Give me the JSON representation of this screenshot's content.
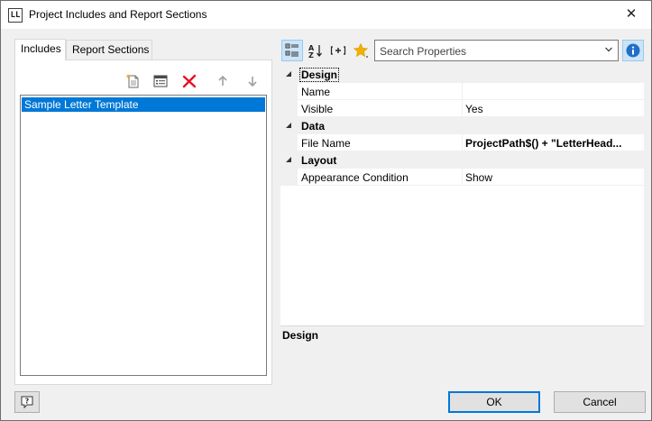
{
  "window": {
    "icon_text": "LL",
    "title": "Project Includes and Report Sections",
    "close_symbol": "✕"
  },
  "left_tabs": [
    {
      "label": "Includes",
      "active": true
    },
    {
      "label": "Report Sections",
      "active": false
    }
  ],
  "left_toolbar": {
    "icons": [
      "new-include-icon",
      "edit-properties-icon",
      "delete-icon",
      "move-up-icon",
      "move-down-icon"
    ]
  },
  "includes_list": {
    "items": [
      {
        "label": "Sample Letter Template",
        "selected": true
      }
    ]
  },
  "property_toolbar": {
    "icons": [
      "categorized-view-icon",
      "sort-alphabetical-icon",
      "expand-all-icon",
      "favorites-star-icon"
    ],
    "search_placeholder": "Search Properties",
    "info_icon": "info-icon"
  },
  "property_grid": {
    "categories": [
      {
        "name": "Design",
        "properties": [
          {
            "name": "Name",
            "value": ""
          },
          {
            "name": "Visible",
            "value": "Yes"
          }
        ]
      },
      {
        "name": "Data",
        "properties": [
          {
            "name": "File Name",
            "value": "ProjectPath$() + \"LetterHead..."
          }
        ]
      },
      {
        "name": "Layout",
        "properties": [
          {
            "name": "Appearance Condition",
            "value": "Show"
          }
        ]
      }
    ]
  },
  "description": {
    "title": "Design"
  },
  "footer": {
    "ok_label": "OK",
    "cancel_label": "Cancel",
    "help_icon": "help-icon"
  },
  "colors": {
    "selection": "#0078d7",
    "dialog_bg": "#f0f0f0",
    "pressed_bg": "#cce4f7",
    "delete_red": "#e81123",
    "star_gold": "#f4b000"
  }
}
